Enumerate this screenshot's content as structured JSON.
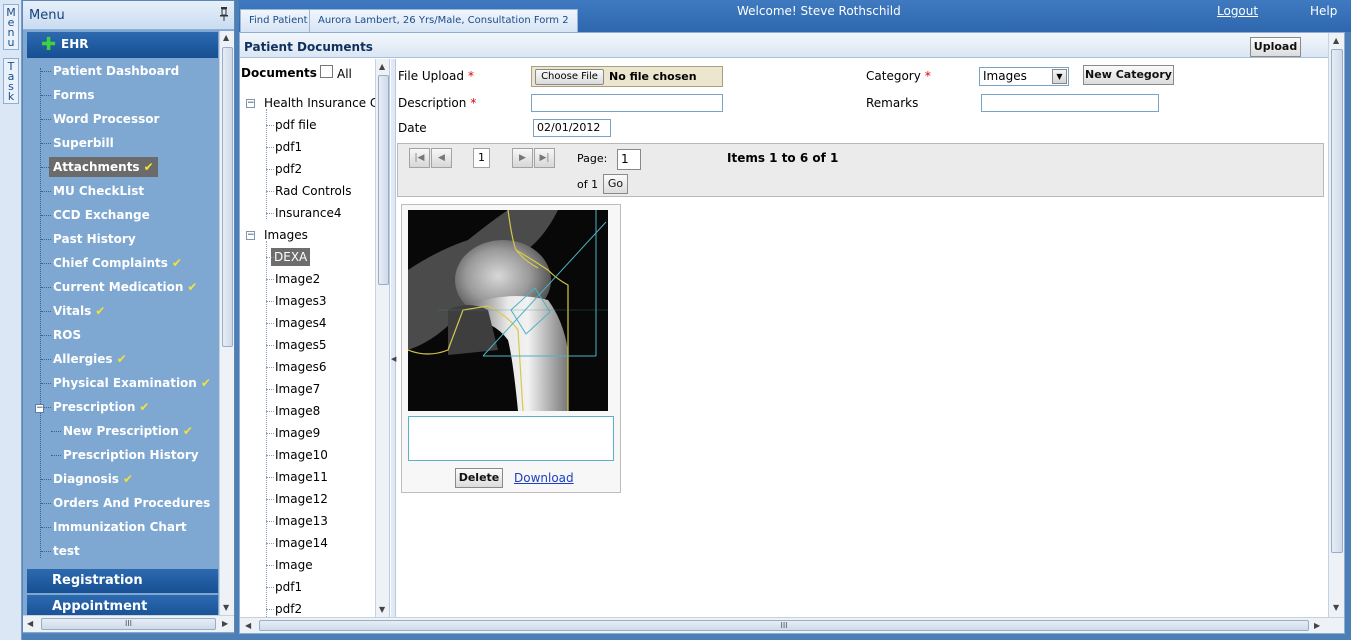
{
  "strip": {
    "menu_tab": [
      "M",
      "e",
      "n",
      "u"
    ],
    "task_tab": [
      "T",
      "a",
      "s",
      "k"
    ]
  },
  "menu": {
    "title": "Menu",
    "section": "EHR",
    "items": [
      {
        "label": "Patient Dashboard",
        "checked": false
      },
      {
        "label": "Forms",
        "checked": false
      },
      {
        "label": "Word Processor",
        "checked": false
      },
      {
        "label": "Superbill",
        "checked": false
      },
      {
        "label": "Attachments",
        "checked": true,
        "active": true
      },
      {
        "label": "MU CheckList",
        "checked": false
      },
      {
        "label": "CCD Exchange",
        "checked": false
      },
      {
        "label": "Past History",
        "checked": false
      },
      {
        "label": "Chief Complaints",
        "checked": true
      },
      {
        "label": "Current Medication",
        "checked": true
      },
      {
        "label": "Vitals",
        "checked": true
      },
      {
        "label": "ROS",
        "checked": false
      },
      {
        "label": "Allergies",
        "checked": true
      },
      {
        "label": "Physical Examination",
        "checked": true
      },
      {
        "label": "Prescription",
        "checked": true
      },
      {
        "label": "New Prescription",
        "checked": true,
        "sub": true
      },
      {
        "label": "Prescription History",
        "checked": false,
        "sub": true
      },
      {
        "label": "Diagnosis",
        "checked": true
      },
      {
        "label": "Orders And Procedures",
        "checked": false
      },
      {
        "label": "Immunization Chart",
        "checked": false
      },
      {
        "label": "test",
        "checked": false
      }
    ],
    "check_glyph": "✔",
    "registration": "Registration",
    "appointment": "Appointment"
  },
  "topbar": {
    "tab1": "Find Patient",
    "tab2": "Aurora Lambert, 26 Yrs/Male, Consultation Form 2",
    "welcome": "Welcome! Steve Rothschild",
    "logout": "Logout",
    "help": "Help"
  },
  "panel": {
    "title": "Patient Documents",
    "upload": "Upload"
  },
  "tree": {
    "header": "Documents",
    "all": "All",
    "group1": "Health Insurance C",
    "group1_items": [
      "pdf file",
      "pdf1",
      "pdf2",
      "Rad Controls",
      "Insurance4"
    ],
    "group2": "Images",
    "group2_items": [
      "DEXA",
      "Image2",
      "Images3",
      "Images4",
      "Images5",
      "Images6",
      "Image7",
      "Image8",
      "Image9",
      "Image10",
      "Image11",
      "Image12",
      "Image13",
      "Image14",
      "Image",
      "pdf1",
      "pdf2"
    ]
  },
  "form": {
    "file_upload": "File Upload",
    "choose_file": "Choose File",
    "no_file": "No file chosen",
    "category": "Category",
    "category_value": "Images",
    "new_category": "New Category",
    "description": "Description",
    "remarks": "Remarks",
    "date": "Date",
    "date_value": "02/01/2012",
    "required": "*"
  },
  "pager": {
    "current": "1",
    "page_label": "Page:",
    "page_value": "1",
    "of_label": "of 1",
    "go": "Go",
    "items": "Items 1 to 6 of 1"
  },
  "card": {
    "delete": "Delete",
    "download": "Download"
  }
}
